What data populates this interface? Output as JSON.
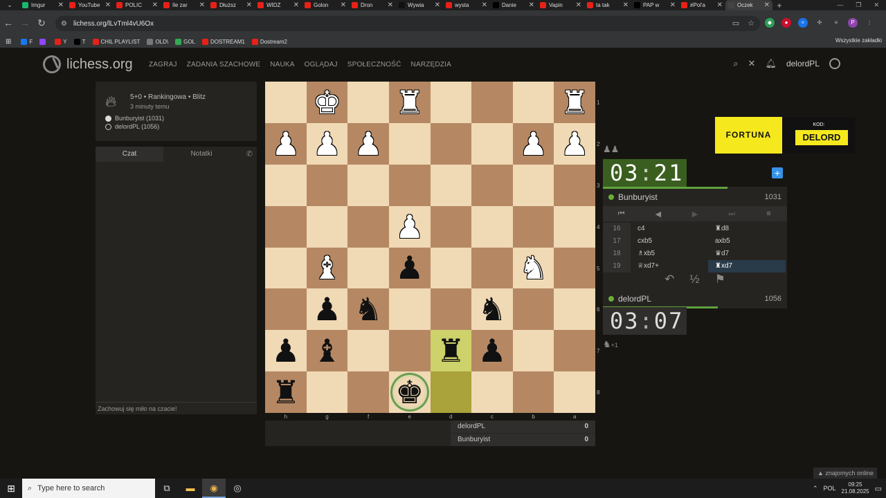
{
  "browser": {
    "tabs": [
      {
        "label": "Imgur",
        "color": "#1bb76e",
        "active": false
      },
      {
        "label": "YouTube",
        "color": "#e62117",
        "active": false
      },
      {
        "label": "POLIC",
        "color": "#e62117",
        "active": false
      },
      {
        "label": "Ile zar",
        "color": "#e62117",
        "active": false
      },
      {
        "label": "Dłuższ",
        "color": "#e62117",
        "active": false
      },
      {
        "label": "WIDZ",
        "color": "#e62117",
        "active": false
      },
      {
        "label": "Golon",
        "color": "#e62117",
        "active": false
      },
      {
        "label": "Dron",
        "color": "#e62117",
        "active": false
      },
      {
        "label": "Wywia",
        "color": "#111111",
        "active": false
      },
      {
        "label": "wysta",
        "color": "#e62117",
        "active": false
      },
      {
        "label": "Danie",
        "color": "#000000",
        "active": false
      },
      {
        "label": "Vapin",
        "color": "#e62117",
        "active": false
      },
      {
        "label": "ta tak",
        "color": "#e62117",
        "active": false
      },
      {
        "label": "PAP w",
        "color": "#000000",
        "active": false
      },
      {
        "label": "#Pol'a",
        "color": "#e62117",
        "active": false
      },
      {
        "label": "Oczek",
        "color": "#444444",
        "active": true
      }
    ],
    "url": "lichess.org/lLvTml4vU6Ox",
    "bookmarks": [
      {
        "label": "F",
        "color": "#1877f2"
      },
      {
        "label": "",
        "color": "#9146ff"
      },
      {
        "label": "Y",
        "color": "#e62117"
      },
      {
        "label": "T",
        "color": "#000000"
      },
      {
        "label": "CHIL PLAYLIST",
        "color": "#e62117"
      },
      {
        "label": "OLD\\",
        "color": "#777777"
      },
      {
        "label": "GOL",
        "color": "#34a853"
      },
      {
        "label": "DOSTREAM1",
        "color": "#e62117"
      },
      {
        "label": "Dostream2",
        "color": "#e62117"
      }
    ],
    "all_bookmarks": "Wszystkie zakładki"
  },
  "site": {
    "logo": "lichess.org",
    "nav": [
      "ZAGRAJ",
      "ZADANIA SZACHOWE",
      "NAUKA",
      "OGLĄDAJ",
      "SPOŁECZNOŚĆ",
      "NARZĘDZIA"
    ],
    "username": "delordPL"
  },
  "game_info": {
    "type": "5+0 • Rankingowa • Blitz",
    "time": "3 minuty temu",
    "white": "Bunburyist (1031)",
    "black": "delordPL (1056)"
  },
  "chat": {
    "tab_chat": "Czat",
    "tab_notes": "Notatki",
    "footer": "Zachowuj się miło na czacie!"
  },
  "board": {
    "ranks": [
      "1",
      "2",
      "3",
      "4",
      "5",
      "6",
      "7",
      "8"
    ],
    "files": [
      "h",
      "g",
      "f",
      "e",
      "d",
      "c",
      "b",
      "a"
    ],
    "squares": [
      [
        "",
        "wK",
        "",
        "wR",
        "",
        "",
        "",
        "wR"
      ],
      [
        "wP",
        "wP",
        "wP",
        "",
        "",
        "",
        "wP",
        "wP"
      ],
      [
        "",
        "",
        "",
        "",
        "",
        "",
        "",
        ""
      ],
      [
        "",
        "",
        "",
        "wP",
        "",
        "",
        "",
        ""
      ],
      [
        "",
        "wB",
        "",
        "bP",
        "",
        "",
        "wN",
        ""
      ],
      [
        "",
        "bP",
        "bN",
        "",
        "",
        "bN",
        "",
        ""
      ],
      [
        "bP",
        "bB",
        "",
        "",
        "bR",
        "bP",
        "",
        ""
      ],
      [
        "bR",
        "",
        "",
        "bK",
        "",
        "",
        "",
        ""
      ]
    ],
    "check_square": "e8",
    "last_move": [
      "d7",
      "d8"
    ]
  },
  "crosstable": {
    "rows": [
      {
        "name": "delordPL",
        "score": "0"
      },
      {
        "name": "Bunburyist",
        "score": "0"
      }
    ]
  },
  "ad": {
    "brand": "FORTUNA",
    "kod_label": "KOD:",
    "code": "DELORD"
  },
  "clocks": {
    "top_min": "03",
    "top_sec": "21",
    "bottom_min": "03",
    "bottom_sec": "07"
  },
  "players": {
    "top": {
      "name": "Bunburyist",
      "rating": "1031"
    },
    "bottom": {
      "name": "delordPL",
      "rating": "1056"
    }
  },
  "moves": [
    {
      "no": "16",
      "white": "c4",
      "black": "♜d8"
    },
    {
      "no": "17",
      "white": "cxb5",
      "black": "axb5"
    },
    {
      "no": "18",
      "white": "♗xb5",
      "black": "♛d7"
    },
    {
      "no": "19",
      "white": "♕xd7+",
      "black": "♜xd7"
    }
  ],
  "current_move": "19b",
  "material_bottom": "+1",
  "friends": "znajomych online",
  "taskbar": {
    "search_placeholder": "Type here to search",
    "lang": "POL",
    "time": "09:25",
    "date": "21.08.2025"
  }
}
